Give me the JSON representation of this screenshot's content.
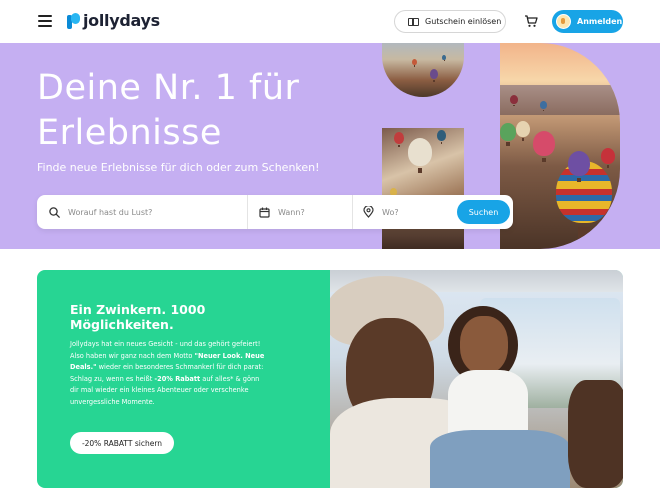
{
  "header": {
    "brand": "jollydays",
    "voucher_label": "Gutschein einlösen",
    "login_label": "Anmelden"
  },
  "hero": {
    "title_line1": "Deine Nr. 1 für",
    "title_line2": "Erlebnisse",
    "subtitle": "Finde neue Erlebnisse für dich oder zum Schenken!"
  },
  "search": {
    "what_placeholder": "Worauf hast du Lust?",
    "when_placeholder": "Wann?",
    "where_placeholder": "Wo?",
    "button_label": "Suchen"
  },
  "promo": {
    "title": "Ein Zwinkern. 1000 Möglichkeiten.",
    "body_1": "Jollydays hat ein neues Gesicht - und das gehört gefeiert! Also haben wir ganz nach dem Motto ",
    "body_bold_1": "\"Neuer Look. Neue Deals.\"",
    "body_2": " wieder ein besonderes Schmankerl für dich parat: Schlag zu, wenn es heißt ",
    "body_bold_2": "-20% Rabatt",
    "body_3": " auf alles* & gönn dir mal wieder ein kleines Abenteuer oder verschenke unvergessliche Momente.",
    "button_label": "-20% RABATT sichern"
  },
  "colors": {
    "hero_bg": "#c5aff2",
    "accent_blue": "#18a4e6",
    "promo_green": "#27d593"
  }
}
